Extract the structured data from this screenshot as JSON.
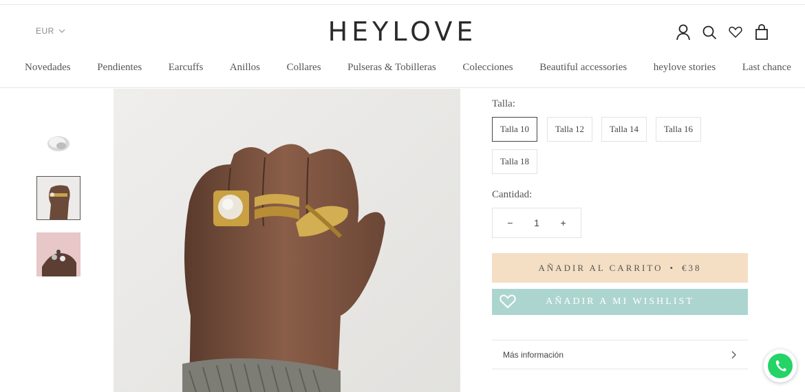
{
  "header": {
    "currency": "EUR",
    "logo": "HEYLOVE",
    "icons": [
      "account-icon",
      "search-icon",
      "wishlist-heart-icon",
      "cart-bag-icon"
    ]
  },
  "nav": {
    "items": [
      "Novedades",
      "Pendientes",
      "Earcuffs",
      "Anillos",
      "Collares",
      "Pulseras & Tobilleras",
      "Colecciones",
      "Beautiful accessories",
      "heylove stories",
      "Last chance"
    ]
  },
  "gallery": {
    "selected_index": 1
  },
  "product": {
    "size_label": "Talla:",
    "sizes": [
      "Talla 10",
      "Talla 12",
      "Talla 14",
      "Talla 16",
      "Talla 18"
    ],
    "selected_size": "Talla 10",
    "quantity_label": "Cantidad:",
    "quantity_minus": "−",
    "quantity": "1",
    "quantity_plus": "+",
    "add_to_cart": "AÑADIR AL CARRITO",
    "separator": "•",
    "price": "€38",
    "add_to_wishlist": "AÑADIR A MI WISHLIST",
    "more_info": "Más información"
  },
  "colors": {
    "cart_button": "#f4dfc5",
    "wishlist_button": "#add5cf",
    "whatsapp": "#25d366"
  }
}
